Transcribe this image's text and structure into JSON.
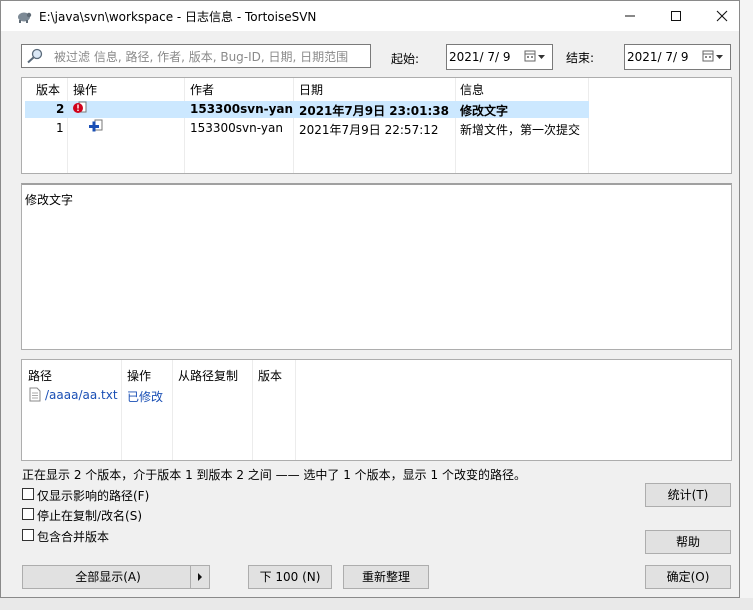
{
  "window": {
    "title": "E:\\java\\svn\\workspace - 日志信息 - TortoiseSVN",
    "icon": "tortoisesvn-icon"
  },
  "filter": {
    "placeholder": "被过滤 信息, 路径, 作者, 版本, Bug-ID, 日期, 日期范围",
    "value": "",
    "from_label": "起始:",
    "from_date": "2021/  7/  9",
    "to_label": "结束:",
    "to_date": "2021/  7/  9"
  },
  "log_table": {
    "columns": [
      "版本",
      "操作",
      "作者",
      "日期",
      "信息"
    ],
    "rows": [
      {
        "revision": "2",
        "action_icon": "modified-icon",
        "author": "153300svn-yan",
        "date": "2021年7月9日 23:01:38",
        "message": "修改文字",
        "selected": true
      },
      {
        "revision": "1",
        "action_icon": "added-icon",
        "author": "153300svn-yan",
        "date": "2021年7月9日 22:57:12",
        "message": "新增文件，第一次提交",
        "selected": false
      }
    ]
  },
  "message_panel": {
    "text": "修改文字"
  },
  "path_table": {
    "columns": [
      "路径",
      "操作",
      "从路径复制",
      "版本"
    ],
    "rows": [
      {
        "path": "/aaaa/aa.txt",
        "action": "已修改",
        "copy_from": "",
        "revision": ""
      }
    ]
  },
  "status": "正在显示 2 个版本，介于版本 1 到版本 2 之间 —— 选中了 1 个版本，显示 1 个改变的路径。",
  "options": {
    "affected_paths_only": "仅显示影响的路径(F)",
    "stop_on_copy": "停止在复制/改名(S)",
    "include_merged": "包含合并版本"
  },
  "buttons": {
    "statistics": "统计(T)",
    "help": "帮助",
    "ok": "确定(O)",
    "show_all": "全部显示(A)",
    "next_100": "下 100 (N)",
    "refresh": "重新整理"
  },
  "colors": {
    "selection": "#cce8ff",
    "link": "#1a4fb5",
    "modified": "#d0021b",
    "added": "#1a4fb5"
  }
}
